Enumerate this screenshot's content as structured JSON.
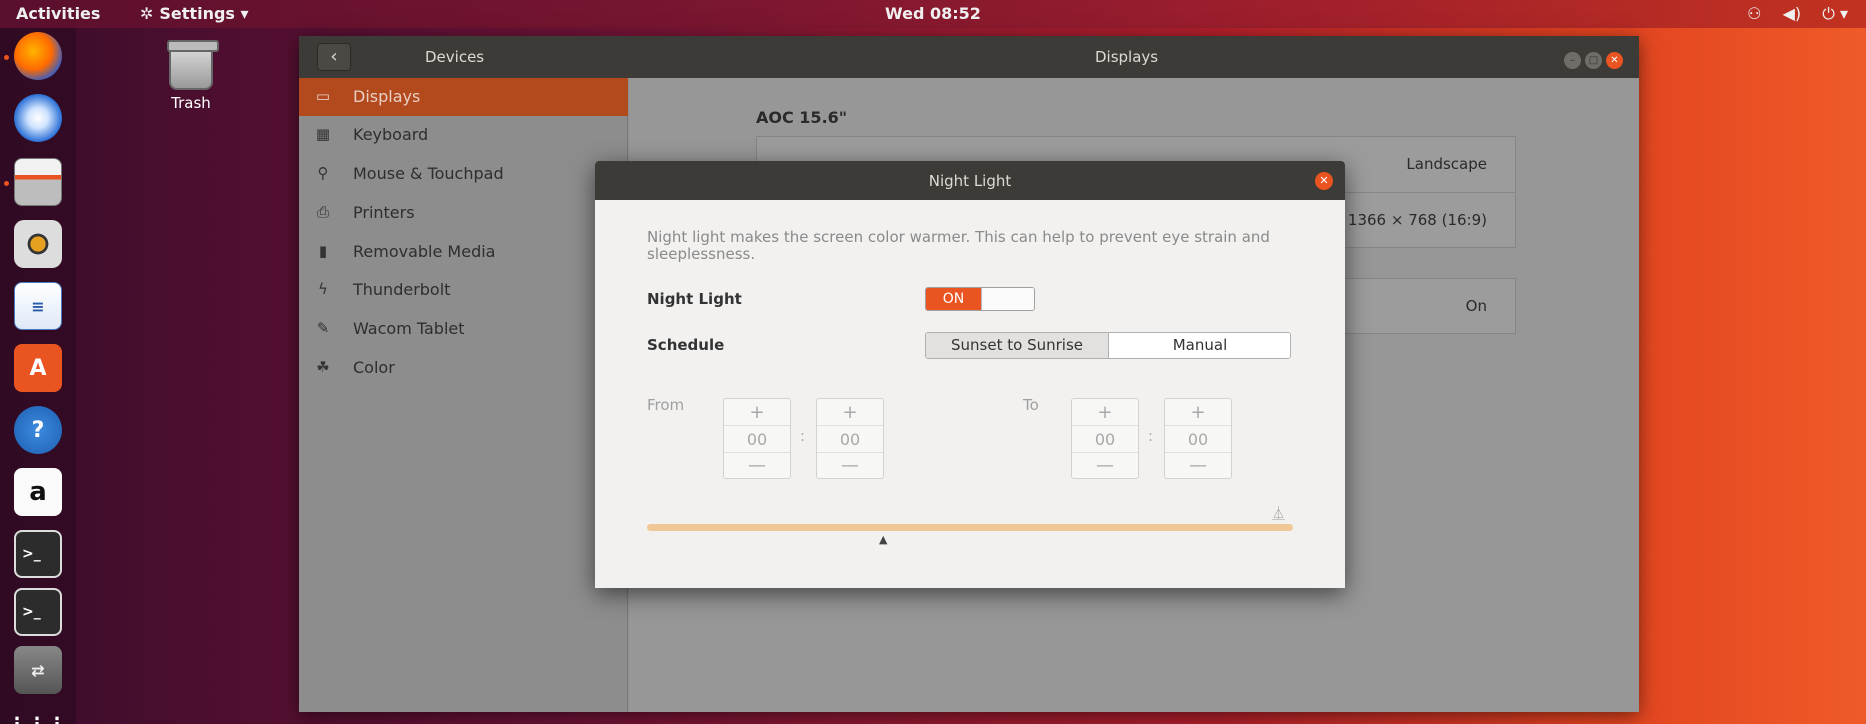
{
  "topbar": {
    "activities": "Activities",
    "app_menu": "Settings ▾",
    "clock": "Wed 08:52",
    "status_icons": [
      "network-icon",
      "volume-icon",
      "power-icon"
    ]
  },
  "dock": {
    "items": [
      "firefox",
      "thunderbird",
      "files",
      "rhythmbox",
      "libreoffice-writer",
      "ubuntu-software",
      "help",
      "amazon",
      "terminal",
      "terminal",
      "remmina",
      "show-applications"
    ],
    "show_apps_glyph": "⋮⋮⋮"
  },
  "desktop": {
    "trash_label": "Trash"
  },
  "settings": {
    "panel_title": "Devices",
    "window_title": "Displays",
    "back_glyph": "‹",
    "sidebar": {
      "items": [
        {
          "label": "Displays",
          "icon": "display-icon"
        },
        {
          "label": "Keyboard",
          "icon": "keyboard-icon"
        },
        {
          "label": "Mouse & Touchpad",
          "icon": "mouse-icon"
        },
        {
          "label": "Printers",
          "icon": "printer-icon"
        },
        {
          "label": "Removable Media",
          "icon": "usb-icon"
        },
        {
          "label": "Thunderbolt",
          "icon": "thunderbolt-icon"
        },
        {
          "label": "Wacom Tablet",
          "icon": "tablet-icon"
        },
        {
          "label": "Color",
          "icon": "color-icon"
        }
      ],
      "active_index": 0
    },
    "display": {
      "monitor_name": "AOC 15.6\"",
      "orientation_value": "Landscape",
      "resolution_value": "1366 × 768 (16:9)",
      "night_light_value": "On"
    }
  },
  "night_light_dialog": {
    "title": "Night Light",
    "description": "Night light makes the screen color warmer. This can help to prevent eye strain and sleeplessness.",
    "night_light_label": "Night Light",
    "switch_state": "ON",
    "schedule_label": "Schedule",
    "schedule_options": [
      "Sunset to Sunrise",
      "Manual"
    ],
    "schedule_selected": "Sunset to Sunrise",
    "from_label": "From",
    "to_label": "To",
    "from_hours": "00",
    "from_minutes": "00",
    "to_hours": "00",
    "to_minutes": "00",
    "plus_glyph": "+",
    "minus_glyph": "—",
    "colon": ":"
  },
  "colors": {
    "accent": "#e95420",
    "titlebar": "#3c3b37",
    "sidebar_active": "#b34a1e",
    "timeline": "#f0c898"
  }
}
